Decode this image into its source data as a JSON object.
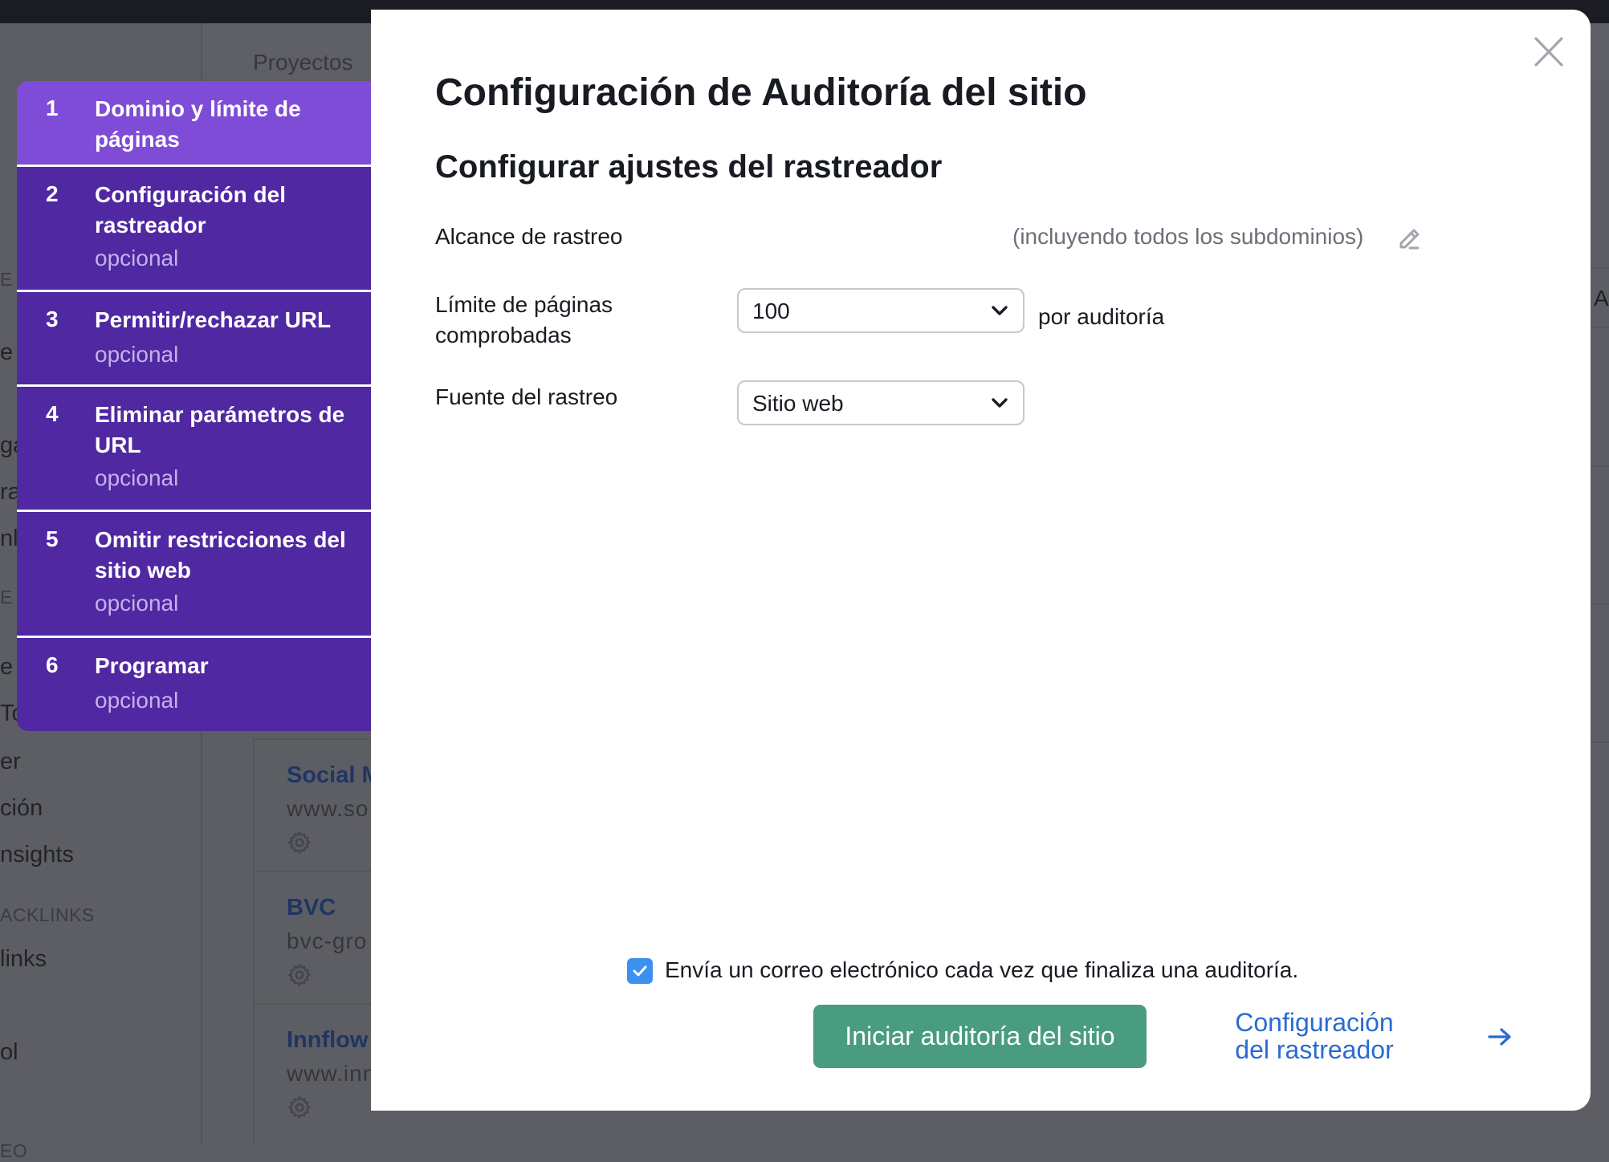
{
  "background": {
    "sidebar_fragments": [
      "E L",
      "e",
      "gá",
      "ra",
      "nl",
      "E P",
      "e",
      "To",
      "er",
      "ción",
      "nsights",
      "ACKLINKS",
      "links",
      "ol",
      "EO"
    ],
    "content_header": "Proyectos",
    "right_fragment": "Ac",
    "project_cards": [
      {
        "title": "Social M",
        "url": "www.so"
      },
      {
        "title": "BVC",
        "url": "bvc-gro"
      },
      {
        "title": "Innflow",
        "url": "www.inn"
      }
    ]
  },
  "stepper": {
    "steps": [
      {
        "number": "1",
        "title": "Dominio y límite de páginas",
        "subtitle": "",
        "active": true
      },
      {
        "number": "2",
        "title": "Configuración del rastreador",
        "subtitle": "opcional",
        "active": false
      },
      {
        "number": "3",
        "title": "Permitir/rechazar URL",
        "subtitle": "opcional",
        "active": false
      },
      {
        "number": "4",
        "title": "Eliminar parámetros de URL",
        "subtitle": "opcional",
        "active": false
      },
      {
        "number": "5",
        "title": "Omitir restricciones del sitio web",
        "subtitle": "opcional",
        "active": false
      },
      {
        "number": "6",
        "title": "Programar",
        "subtitle": "opcional",
        "active": false
      }
    ]
  },
  "modal": {
    "title": "Configuración de Auditoría del sitio",
    "section_title": "Configurar ajustes del rastreador",
    "crawl_scope": {
      "label": "Alcance de rastreo",
      "value": "",
      "note": "(incluyendo todos los subdominios)"
    },
    "page_limit": {
      "label": "Límite de páginas comprobadas",
      "selected": "100",
      "suffix": "por auditoría"
    },
    "crawl_source": {
      "label": "Fuente del rastreo",
      "selected": "Sitio web"
    },
    "email_notification": {
      "label": "Envía un correo electrónico cada vez que finaliza una auditoría.",
      "checked": true
    },
    "start_button": "Iniciar auditoría del sitio",
    "next_link": "Configuración del rastreador"
  },
  "colors": {
    "stepper_active": "#7e4cd7",
    "stepper_bg": "#5028a2",
    "primary_button": "#4a9c80",
    "link": "#2b6bcf",
    "checkbox": "#3d8ff0"
  }
}
